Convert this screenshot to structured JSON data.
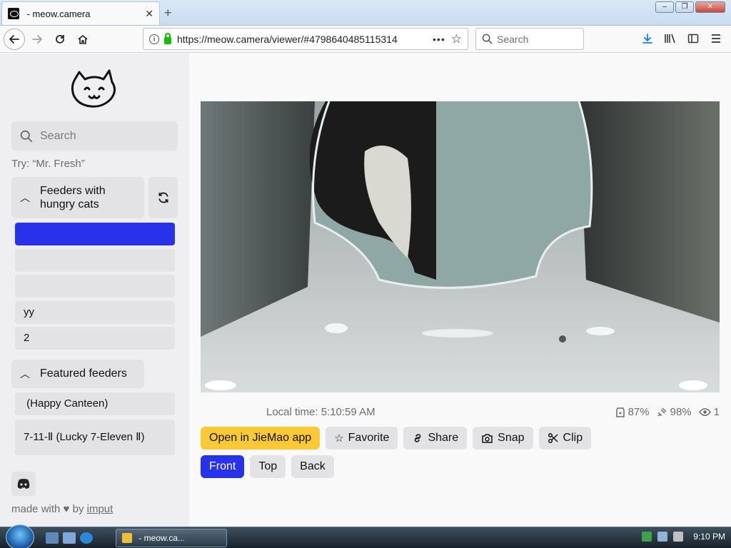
{
  "browser": {
    "tab_title": "󠀠󠀠󠀠 - meow.camera",
    "tab_close": "✕",
    "new_tab": "+",
    "url": "https://meow.camera/viewer/#4798640485115314",
    "search_placeholder": "Search",
    "window_buttons": {
      "minimize": "–",
      "restore": "❐",
      "close": "✕"
    }
  },
  "sidebar": {
    "search_placeholder": "Search",
    "try_hint": "Try: “Mr. Fresh”",
    "group_hungry": {
      "label_line1": "Feeders with",
      "label_line2": "hungry cats"
    },
    "hungry_items": [
      {
        "label": "󠀠󠀠󠀠󠀠󠀠󠀠"
      },
      {
        "label": "󠀠󠀠󠀠󠀠󠀠󠀠"
      },
      {
        "label": "󠀠󠀠󠀠󠀠"
      },
      {
        "label": "󠀠yy"
      },
      {
        "label": "󠀠󠀠󠀠2"
      }
    ],
    "group_featured": {
      "label": "Featured feeders"
    },
    "featured_items": [
      {
        "label": "󠀠󠀠󠀠󠀠󠀠 (Happy Canteen)"
      },
      {
        "label": "󠀠󠀠7-11-Ⅱ (Lucky 7-Eleven Ⅱ)"
      }
    ],
    "made_with_prefix": "made with",
    "made_with_by": "by",
    "made_with_author": "imput"
  },
  "viewer": {
    "camera_label": "󠀠󠀠󠀠󠀠󠀠󠀠",
    "local_time": "Local time: 5:10:59 AM",
    "stats": {
      "food": "87%",
      "battery": "98%",
      "viewers": "1"
    },
    "actions": {
      "open_app": "Open in JieMao app",
      "favorite": "Favorite",
      "share": "Share",
      "snap": "Snap",
      "clip": "Clip"
    },
    "views": {
      "front": "Front",
      "top": "Top",
      "back": "Back"
    }
  },
  "taskbar": {
    "task_label": "󠀠󠀠󠀠󠀠󠀠󠀠 - meow.ca...",
    "clock": "9:10 PM"
  },
  "colors": {
    "accent": "#2832e8",
    "primary_button": "#fcc936",
    "sidebar_bg": "#efeff1",
    "button_bg": "#e3e3e6"
  }
}
